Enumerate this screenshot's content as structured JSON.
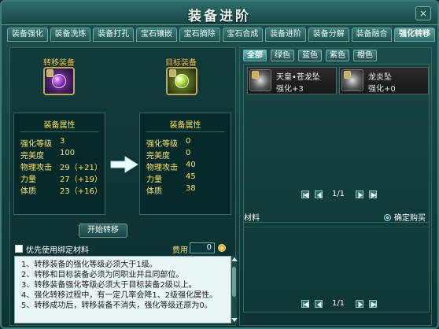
{
  "window": {
    "title": "装备进阶"
  },
  "tabs": [
    "装备强化",
    "装备洗炼",
    "装备打孔",
    "宝石镶嵌",
    "宝石摘除",
    "宝石合成",
    "装备进阶",
    "装备分解",
    "装备融合",
    "强化转移"
  ],
  "transfer": {
    "source_label": "转移装备",
    "target_label": "目标装备",
    "box_title": "装备属性",
    "source_stats": [
      {
        "k": "强化等级",
        "v": "3"
      },
      {
        "k": "完美度",
        "v": "100"
      },
      {
        "k": "物理攻击",
        "v": "29（+21）"
      },
      {
        "k": "力量",
        "v": "27（+19）"
      },
      {
        "k": "体质",
        "v": "23（+16）"
      }
    ],
    "target_stats": [
      {
        "k": "强化等级",
        "v": "0"
      },
      {
        "k": "完美度",
        "v": "0"
      },
      {
        "k": "物理攻击",
        "v": "40"
      },
      {
        "k": "力量",
        "v": "45"
      },
      {
        "k": "体质",
        "v": "38"
      }
    ],
    "start_button": "开始转移",
    "checkbox_label": "优先使用绑定材料",
    "fee_label": "费用：",
    "fee_value": "0"
  },
  "notes": [
    "1、转移装备的强化等级必须大于1级。",
    "2、转移和目标装备必须为同职业并且同部位。",
    "3、转移装备强化等级必须大于目标装备2级以上。",
    "4、强化转移过程中，有一定几率会降1、2级强化属性。",
    "5、转移成功后，转移装备不消失，强化等级还原为0。"
  ],
  "filters": [
    "全部",
    "绿色",
    "蓝色",
    "紫色",
    "橙色"
  ],
  "items": [
    {
      "name": "天皇•苍龙坠",
      "level": "强化+3"
    },
    {
      "name": "龙炎坠",
      "level": "强化+0"
    }
  ],
  "pager_top": "1/1",
  "material": {
    "label": "材料",
    "buy_label": "确定购买"
  },
  "pager_bottom": "1/1",
  "colors": {
    "accent": "#f3e46f",
    "title": "#e9f6ef"
  },
  "icons": {
    "lock": "lock-icon",
    "close": "close-icon",
    "coin": "coin-icon",
    "arrow": "arrow-right-icon"
  }
}
